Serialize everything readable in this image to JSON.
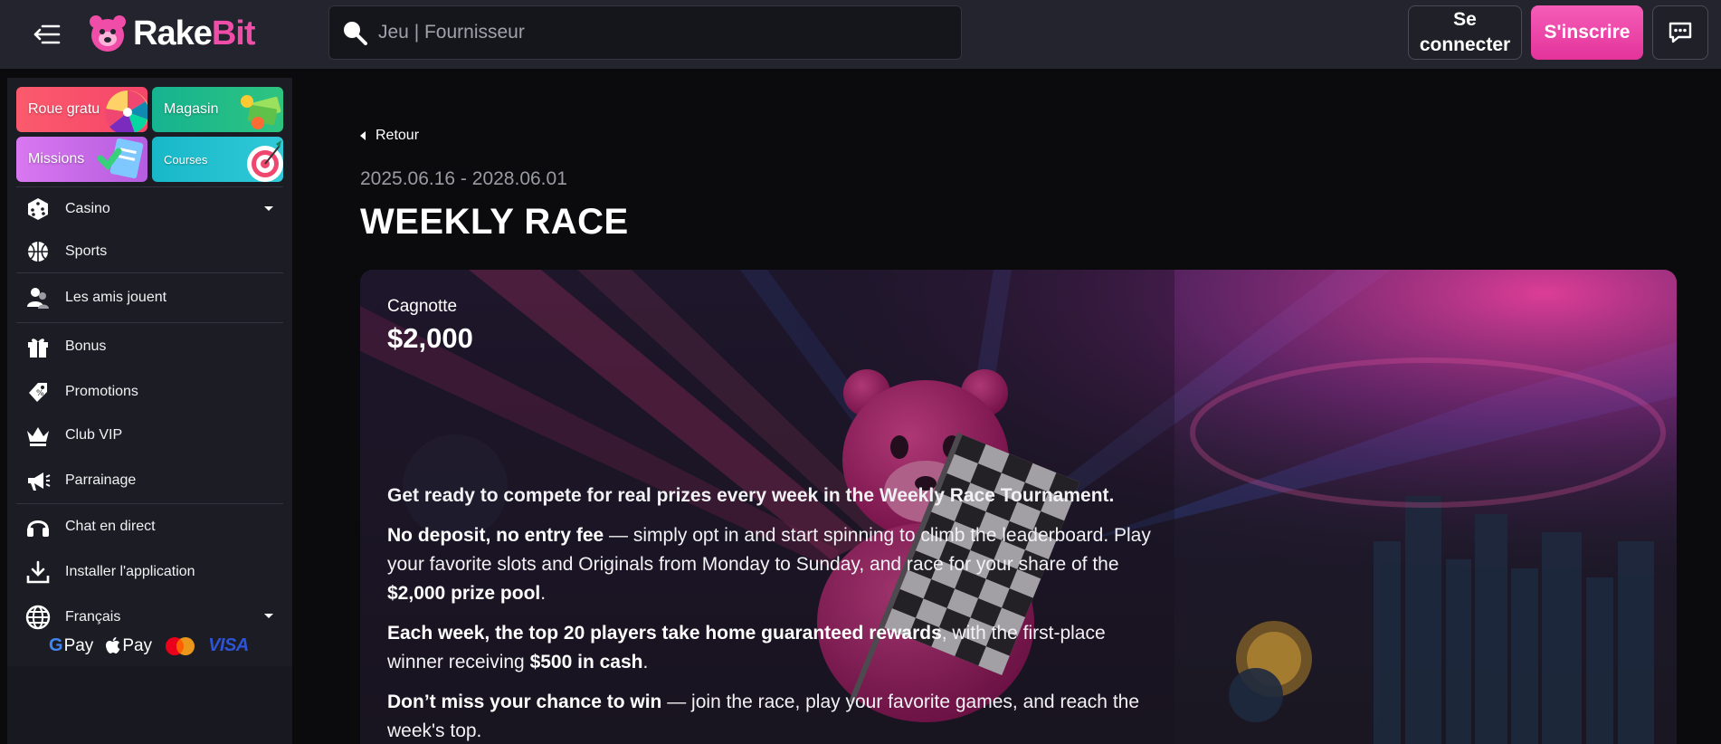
{
  "header": {
    "logo": {
      "rake": "Rake",
      "bit": "Bit"
    },
    "search_placeholder": "Jeu | Fournisseur",
    "login_label": "Se connecter",
    "register_label": "S'inscrire"
  },
  "sidebar": {
    "promo_tiles": [
      {
        "label": "Roue gratu",
        "icon": "wheel-icon"
      },
      {
        "label": "Magasin",
        "icon": "money-icon"
      },
      {
        "label": "Missions",
        "icon": "checklist-icon"
      },
      {
        "label": "Courses",
        "icon": "target-icon"
      }
    ],
    "items": [
      {
        "label": "Casino",
        "icon": "dice-icon"
      },
      {
        "label": "Sports",
        "icon": "basketball-icon"
      },
      {
        "label": "Les amis jouent",
        "icon": "friends-icon"
      },
      {
        "label": "Bonus",
        "icon": "gift-icon"
      },
      {
        "label": "Promotions",
        "icon": "tag-icon"
      },
      {
        "label": "Club VIP",
        "icon": "crown-icon"
      },
      {
        "label": "Parrainage",
        "icon": "megaphone-icon"
      },
      {
        "label": "Chat en direct",
        "icon": "headset-icon"
      },
      {
        "label": "Installer l'application",
        "icon": "download-icon"
      },
      {
        "label": "Français",
        "icon": "globe-icon"
      }
    ],
    "payments": {
      "gpay": "Pay",
      "applepay": "Pay",
      "visa": "VISA"
    }
  },
  "main": {
    "back_label": "Retour",
    "dates": "2025.06.16 - 2028.06.01",
    "title": "WEEKLY RACE",
    "banner": {
      "jackpot_label": "Cagnotte",
      "jackpot_value": "$2,000",
      "intro": "Get ready to compete for real prizes every week in the Weekly Race Tournament.",
      "p1_bold": "No deposit, no entry fee",
      "p1_rest": " — simply opt in and start spinning to climb the leaderboard. Play your favorite slots and Originals from Monday to Sunday, and race for your share of the ",
      "p1_bold2": "$2,000 prize pool",
      "p1_end": ".",
      "p2_bold": "Each week, the top 20 players take home guaranteed rewards",
      "p2_rest": ", with the first-place winner receiving ",
      "p2_bold2": "$500 in cash",
      "p2_end": ".",
      "p3_bold": "Don’t miss your chance to win",
      "p3_rest": " — join the race, play your favorite games, and reach the week's top."
    }
  },
  "colors": {
    "brand_pink": "#f04da8",
    "header_bg": "#23242d",
    "sidebar_bg": "#1c1d24",
    "page_bg": "#0b0b0d"
  }
}
